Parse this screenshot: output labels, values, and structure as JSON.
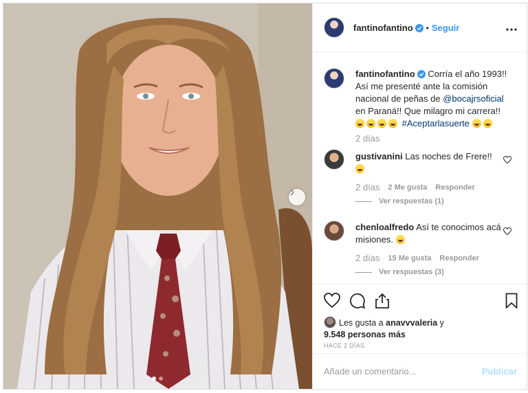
{
  "header": {
    "username": "fantinofantino",
    "follow_separator": "•",
    "follow_label": "Seguir",
    "more_icon": "more-dots-icon"
  },
  "caption": {
    "username": "fantinofantino",
    "text_1": "Corría el año 1993!! Así me presenté ante la comisión nacional de peñas de",
    "mention": "@bocajrsoficial",
    "text_2": "en Paraná!! Que milagro mi carrera!!",
    "hashtag": "#Aceptarlasuerte",
    "time": "2 días"
  },
  "comments": [
    {
      "username": "gustivanini",
      "text": "Las noches de Frere!!",
      "time": "2 días",
      "likes": "2 Me gusta",
      "reply_label": "Responder",
      "view_replies": "Ver respuestas (1)"
    },
    {
      "username": "chenloalfredo",
      "text": "Así te conocimos acá misiones.",
      "time": "2 días",
      "likes": "15 Me gusta",
      "reply_label": "Responder",
      "view_replies": "Ver respuestas (3)"
    }
  ],
  "actions": {
    "like_icon": "heart-icon",
    "comment_icon": "comment-icon",
    "share_icon": "share-icon",
    "save_icon": "bookmark-icon"
  },
  "likes": {
    "prefix": "Les gusta a",
    "user": "anavvvaleria",
    "connector": "y",
    "count": "9.548 personas más"
  },
  "post_time": "HACE 2 DÍAS",
  "add_comment": {
    "placeholder": "Añade un comentario...",
    "publish_label": "Publicar"
  },
  "carousel": {
    "dot_count": 2,
    "active_index": 0
  },
  "colors": {
    "link_blue": "#3897f0",
    "verified_blue": "#3897f0",
    "publish_disabled": "#b2dffc"
  }
}
